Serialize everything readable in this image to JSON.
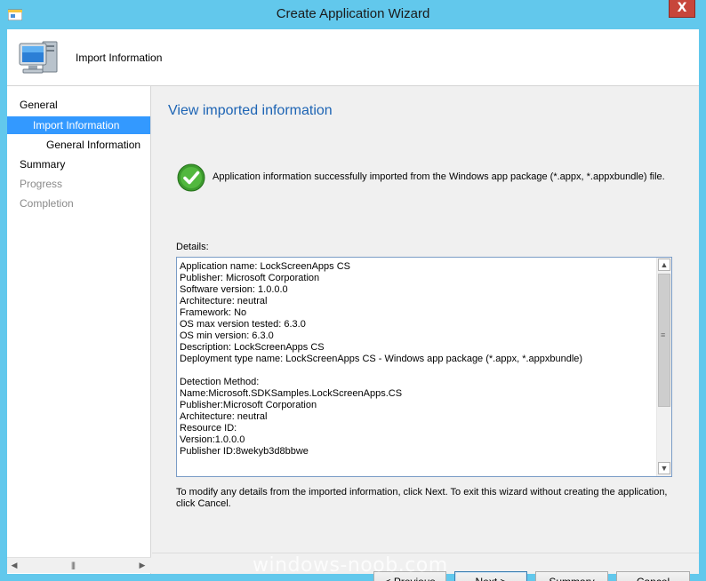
{
  "window": {
    "title": "Create Application Wizard",
    "close_glyph": "X"
  },
  "header": {
    "title": "Import Information",
    "icon": "computer-icon"
  },
  "nav": {
    "items": [
      {
        "label": "General",
        "state": "normal"
      },
      {
        "label": "Import Information",
        "state": "active"
      },
      {
        "label": "General Information",
        "state": "normal"
      },
      {
        "label": "Summary",
        "state": "normal"
      },
      {
        "label": "Progress",
        "state": "disabled"
      },
      {
        "label": "Completion",
        "state": "disabled"
      }
    ]
  },
  "main": {
    "title": "View imported information",
    "success_message": "Application information successfully imported from the Windows app package (*.appx, *.appxbundle) file.",
    "details_label": "Details:",
    "details_lines": [
      "Application name: LockScreenApps CS",
      "Publisher: Microsoft Corporation",
      "Software version: 1.0.0.0",
      "Architecture: neutral",
      "Framework: No",
      "OS max version tested: 6.3.0",
      "OS min version: 6.3.0",
      "Description: LockScreenApps CS",
      "Deployment type name: LockScreenApps CS - Windows app package (*.appx, *.appxbundle)",
      "",
      "Detection Method:",
      "Name:Microsoft.SDKSamples.LockScreenApps.CS",
      "Publisher:Microsoft Corporation",
      "Architecture: neutral",
      "Resource ID:",
      "Version:1.0.0.0",
      "Publisher ID:8wekyb3d8bbwe"
    ],
    "modify_text": "To modify any details from the imported information, click Next. To exit this wizard without creating the application, click Cancel."
  },
  "buttons": {
    "previous": "< Previous",
    "next": "Next >",
    "summary": "Summary",
    "cancel": "Cancel"
  },
  "watermark": "windows-noob.com",
  "colors": {
    "title_bar": "#62c8ec",
    "nav_active": "#3399ff",
    "heading": "#1d64b4",
    "close_button": "#c7463b"
  }
}
